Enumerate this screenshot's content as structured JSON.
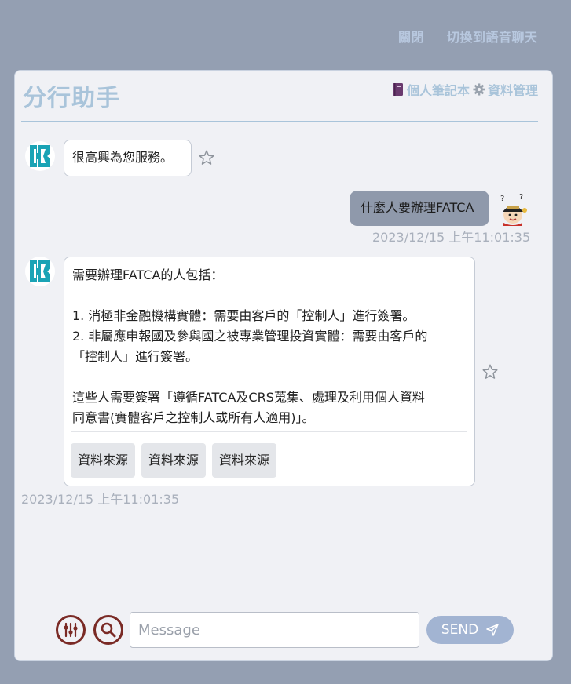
{
  "topbar": {
    "close_label": "關閉",
    "voice_label": "切換到語音聊天"
  },
  "header": {
    "title": "分行助手",
    "notebook_label": "個人筆記本",
    "data_mgmt_label": "資料管理"
  },
  "messages": [
    {
      "role": "bot",
      "text": "很高興為您服務。"
    },
    {
      "role": "user",
      "text": "什麼人要辦理FATCA",
      "timestamp": "2023/12/15 上午11:01:35"
    },
    {
      "role": "bot",
      "lines": [
        "需要辦理FATCA的人包括：",
        "",
        "1. 消極非金融機構實體：需要由客戶的「控制人」進行簽署。",
        "2. 非屬應申報國及參與國之被專業管理投資實體：需要由客戶的",
        "「控制人」進行簽署。",
        "",
        "這些人需要簽署「遵循FATCA及CRS蒐集、處理及利用個人資料",
        "同意書(實體客戶之控制人或所有人適用)」。"
      ],
      "sources": [
        "資料來源",
        "資料來源",
        "資料來源"
      ],
      "timestamp": "2023/12/15 上午11:01:35"
    }
  ],
  "composer": {
    "placeholder": "Message",
    "send_label": "SEND"
  },
  "colors": {
    "background": "#949fb2",
    "panel": "#f0f1f5",
    "accent": "#a9c4da",
    "tool_icon": "#7a2a25",
    "brand_teal": "#1aa3b5"
  }
}
